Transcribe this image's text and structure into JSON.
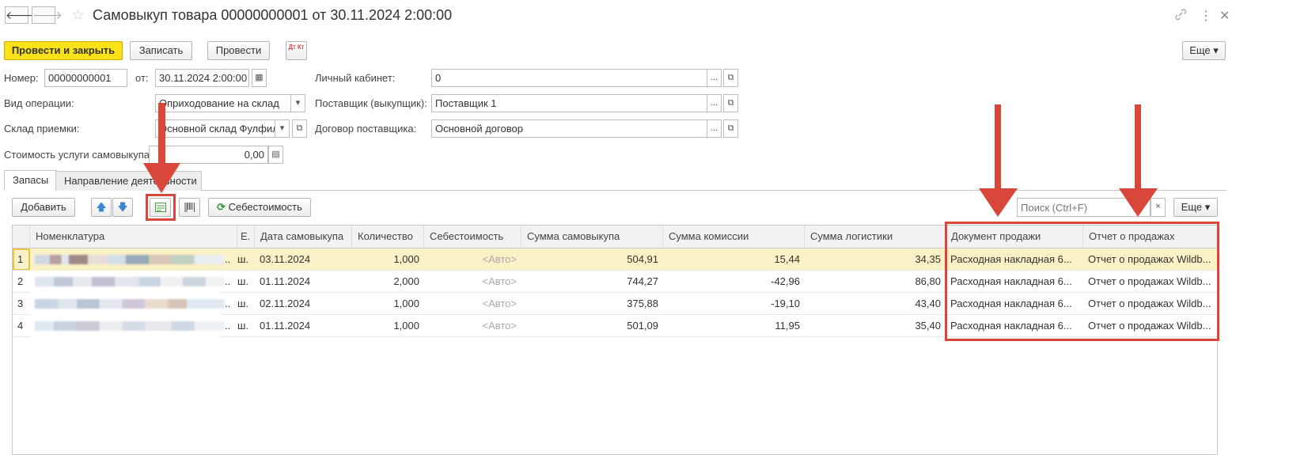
{
  "window": {
    "title": "Самовыкуп товара 00000000001 от 30.11.2024 2:00:00",
    "back_icon": "arrow-left-icon",
    "forward_icon": "arrow-right-icon",
    "star": "☆",
    "link_glyph": "🔗",
    "menu_glyph": "⋮",
    "close_glyph": "✕"
  },
  "toolbar": {
    "post_close": "Провести и закрыть",
    "save": "Записать",
    "post": "Провести",
    "dtkt": "Дт Кт",
    "more": "Еще ▾"
  },
  "form": {
    "number_label": "Номер:",
    "number_value": "00000000001",
    "date_label": "от:",
    "date_value": "30.11.2024  2:00:00",
    "op_type_label": "Вид операции:",
    "op_type_value": "Оприходование на склад",
    "warehouse_label": "Склад приемки:",
    "warehouse_value": "Основной склад Фулфил",
    "service_cost_label": "Стоимость услуги самовыкупа:",
    "service_cost_value": "0,00",
    "cabinet_label": "Личный кабинет:",
    "cabinet_value": "0",
    "supplier_label": "Поставщик (выкупщик):",
    "supplier_value": "Поставщик 1",
    "contract_label": "Договор поставщика:",
    "contract_value": "Основной договор"
  },
  "tabs": [
    {
      "label": "Запасы"
    },
    {
      "label": "Направление деятельности"
    }
  ],
  "table_toolbar": {
    "add": "Добавить",
    "cost": "Себестоимость",
    "search_placeholder": "Поиск (Ctrl+F)",
    "clear": "×",
    "more": "Еще ▾"
  },
  "table": {
    "columns": [
      "Номенклатура",
      "Е.",
      "Дата самовыкупа",
      "Количество",
      "Себестоимость",
      "Сумма самовыкупа",
      "Сумма комиссии",
      "Сумма логистики",
      "Документ продажи",
      "Отчет о продажах"
    ],
    "rows": [
      {
        "n": "1",
        "unit": "ш.",
        "date": "03.11.2024",
        "qty": "1,000",
        "cost": "<Авто>",
        "sum": "504,91",
        "comm": "15,44",
        "log": "34,35",
        "doc": "Расходная накладная 6...",
        "report": "Отчет о продажах Wildb..."
      },
      {
        "n": "2",
        "unit": "ш.",
        "date": "01.11.2024",
        "qty": "2,000",
        "cost": "<Авто>",
        "sum": "744,27",
        "comm": "-42,96",
        "log": "86,80",
        "doc": "Расходная накладная 6...",
        "report": "Отчет о продажах Wildb..."
      },
      {
        "n": "3",
        "unit": "ш.",
        "date": "02.11.2024",
        "qty": "1,000",
        "cost": "<Авто>",
        "sum": "375,88",
        "comm": "-19,10",
        "log": "43,40",
        "doc": "Расходная накладная 6...",
        "report": "Отчет о продажах Wildb..."
      },
      {
        "n": "4",
        "unit": "ш.",
        "date": "01.11.2024",
        "qty": "1,000",
        "cost": "<Авто>",
        "sum": "501,09",
        "comm": "11,95",
        "log": "35,40",
        "doc": "Расходная накладная 6...",
        "report": "Отчет о продажах Wildb..."
      }
    ]
  },
  "colors": {
    "accent_yellow": "#fbe11a",
    "highlight_row": "#fbf1c6",
    "annotation_red": "#d9473a"
  }
}
